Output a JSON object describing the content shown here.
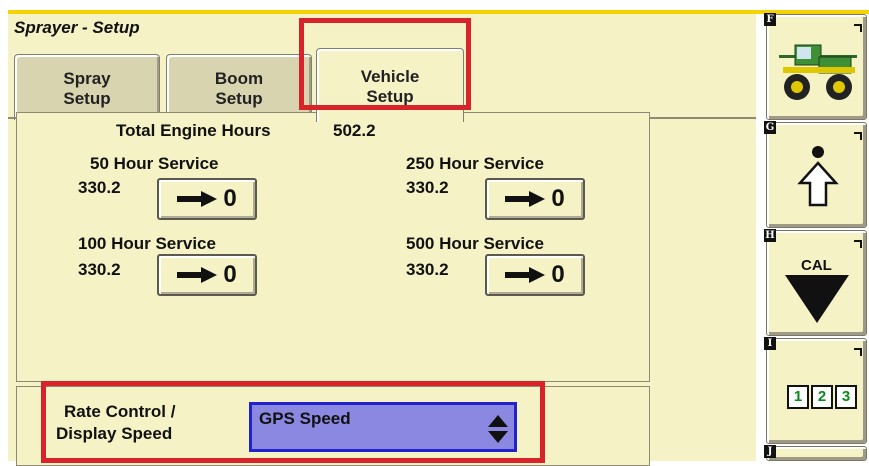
{
  "window": {
    "title": "Sprayer - Setup"
  },
  "tabs": [
    {
      "line1": "Spray",
      "line2": "Setup"
    },
    {
      "line1": "Boom",
      "line2": "Setup"
    },
    {
      "line1": "Vehicle",
      "line2": "Setup"
    }
  ],
  "engine": {
    "label": "Total Engine Hours",
    "value": "502.2"
  },
  "services": [
    {
      "label": "50 Hour Service",
      "hours": "330.2",
      "reset_value": "0"
    },
    {
      "label": "250 Hour Service",
      "hours": "330.2",
      "reset_value": "0"
    },
    {
      "label": "100 Hour Service",
      "hours": "330.2",
      "reset_value": "0"
    },
    {
      "label": "500 Hour Service",
      "hours": "330.2",
      "reset_value": "0"
    }
  ],
  "rate_control": {
    "label_line1": "Rate Control /",
    "label_line2": "Display Speed",
    "selected": "GPS Speed"
  },
  "softkeys": [
    {
      "letter": "F",
      "icon": "sprayer-machine-icon"
    },
    {
      "letter": "G",
      "icon": "home-arrow-up-icon"
    },
    {
      "letter": "H",
      "icon": "cal-down-triangle-icon",
      "label": "CAL"
    },
    {
      "letter": "I",
      "icon": "numeric-keypad-icon",
      "digits": [
        "1",
        "2",
        "3"
      ]
    },
    {
      "letter": "J",
      "icon": ""
    }
  ],
  "colors": {
    "background": "#f5f2c6",
    "accent_rule": "#f3d200",
    "highlight": "#d8232a",
    "dropdown_fill": "#8a88e0",
    "dropdown_border": "#2222c8"
  }
}
